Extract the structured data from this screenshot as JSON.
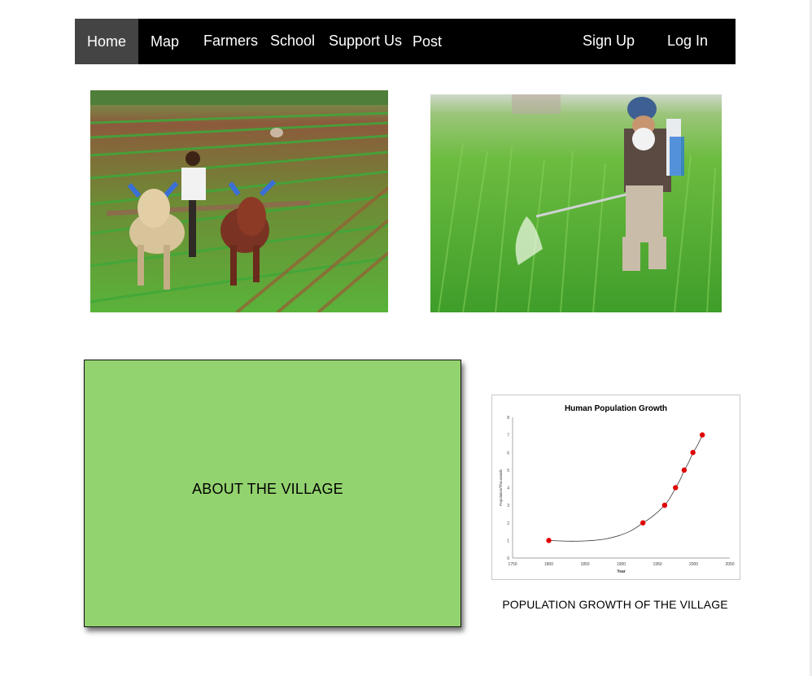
{
  "nav": {
    "home": "Home",
    "map": "Map",
    "farmers": "Farmers",
    "school": "School",
    "support": "Support Us",
    "post": "Post",
    "signup": "Sign Up",
    "login": "Log In"
  },
  "about": {
    "label": "ABOUT THE VILLAGE"
  },
  "chart_caption": "POPULATION GROWTH OF THE VILLAGE",
  "colors": {
    "nav_bg": "#000000",
    "nav_active": "#444444",
    "about_bg": "#93d36f",
    "marker": "#e00000"
  },
  "chart_data": {
    "type": "scatter",
    "title": "Human Population Growth",
    "xlabel": "Year",
    "ylabel": "Population/Thousands",
    "xlim": [
      1750,
      2050
    ],
    "ylim": [
      0,
      8
    ],
    "x_ticks": [
      1750,
      1800,
      1850,
      1900,
      1950,
      2000,
      2050
    ],
    "y_ticks": [
      0,
      1,
      2,
      3,
      4,
      5,
      6,
      7,
      8
    ],
    "points": [
      {
        "x": 1800,
        "y": 1
      },
      {
        "x": 1930,
        "y": 2
      },
      {
        "x": 1960,
        "y": 3
      },
      {
        "x": 1975,
        "y": 4
      },
      {
        "x": 1987,
        "y": 5
      },
      {
        "x": 1999,
        "y": 6
      },
      {
        "x": 2012,
        "y": 7
      }
    ],
    "trendline": true,
    "grid": false
  }
}
